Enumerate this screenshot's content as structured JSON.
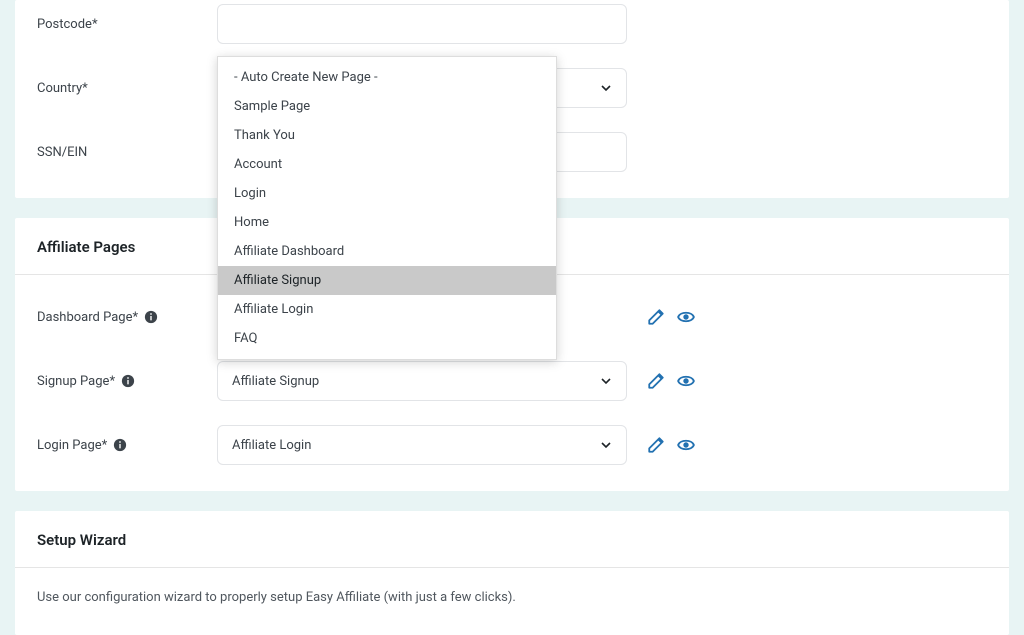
{
  "form": {
    "postcode_label": "Postcode*",
    "country_label": "Country*",
    "ssn_label": "SSN/EIN"
  },
  "dropdown": {
    "items": [
      "- Auto Create New Page -",
      "Sample Page",
      "Thank You",
      "Account",
      "Login",
      "Home",
      "Affiliate Dashboard",
      "Affiliate Signup",
      "Affiliate Login",
      "FAQ"
    ],
    "highlight_index": 7
  },
  "affiliate_pages": {
    "title": "Affiliate Pages",
    "dashboard_label": "Dashboard Page*",
    "signup_label": "Signup Page*",
    "signup_value": "Affiliate Signup",
    "login_label": "Login Page*",
    "login_value": "Affiliate Login"
  },
  "setup_wizard": {
    "title": "Setup Wizard",
    "text": "Use our configuration wizard to properly setup Easy Affiliate (with just a few clicks)."
  }
}
